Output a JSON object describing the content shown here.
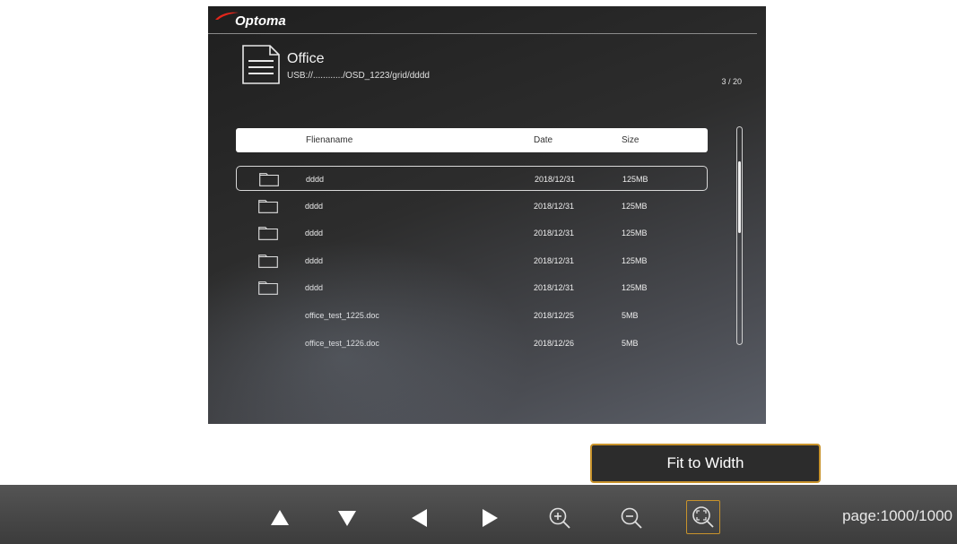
{
  "brand": {
    "name": "Optoma",
    "accent": "#e3261b"
  },
  "folder": {
    "title": "Office",
    "path": "USB://............/OSD_1223/grid/dddd",
    "page_count": "3 / 20",
    "icon": "document-icon"
  },
  "table": {
    "headers": {
      "name": "Flienaname",
      "date": "Date",
      "size": "Size"
    },
    "rows": [
      {
        "type": "folder",
        "icon": "folder-icon",
        "name": "dddd",
        "date": "2018/12/31",
        "size": "125MB",
        "selected": true
      },
      {
        "type": "folder",
        "icon": "folder-icon",
        "name": "dddd",
        "date": "2018/12/31",
        "size": "125MB"
      },
      {
        "type": "folder",
        "icon": "folder-icon",
        "name": "dddd",
        "date": "2018/12/31",
        "size": "125MB"
      },
      {
        "type": "folder",
        "icon": "folder-icon",
        "name": "dddd",
        "date": "2018/12/31",
        "size": "125MB"
      },
      {
        "type": "folder",
        "icon": "folder-icon",
        "name": "dddd",
        "date": "2018/12/31",
        "size": "125MB"
      },
      {
        "type": "file",
        "name": "office_test_1225.doc",
        "date": "2018/12/25",
        "size": "5MB"
      },
      {
        "type": "file",
        "name": "office_test_1226.doc",
        "date": "2018/12/26",
        "size": "5MB"
      }
    ]
  },
  "tooltip": {
    "label": "Fit to Width"
  },
  "toolbar": {
    "buttons": [
      {
        "icon": "arrow-up-icon"
      },
      {
        "icon": "arrow-down-icon"
      },
      {
        "icon": "arrow-left-icon"
      },
      {
        "icon": "arrow-right-icon"
      },
      {
        "icon": "zoom-in-icon"
      },
      {
        "icon": "zoom-out-icon"
      },
      {
        "icon": "fit-to-width-icon",
        "active": true
      }
    ],
    "page_indicator": "page:1000/1000"
  },
  "colors": {
    "highlight": "#c8932c",
    "toolbar": "#484848"
  }
}
